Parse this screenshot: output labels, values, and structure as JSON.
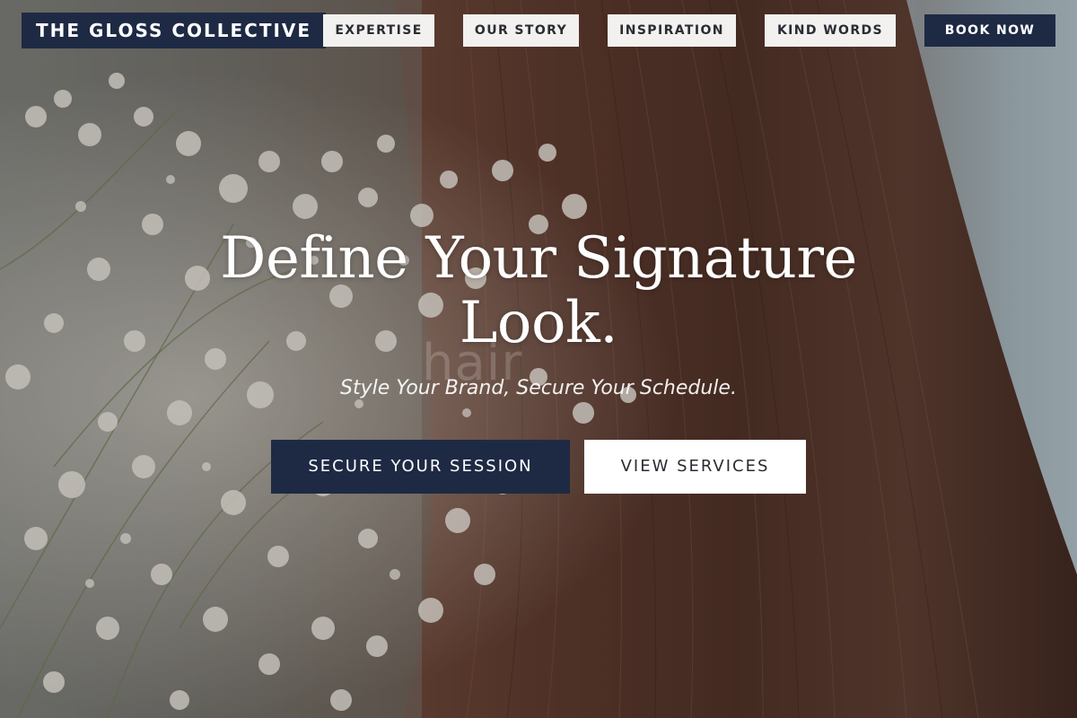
{
  "header": {
    "brand": "THE GLOSS COLLECTIVE",
    "nav": [
      {
        "id": "expertise",
        "label": "EXPERTISE"
      },
      {
        "id": "our-story",
        "label": "OUR STORY"
      },
      {
        "id": "inspiration",
        "label": "INSPIRATION"
      },
      {
        "id": "kind-words",
        "label": "KIND WORDS"
      }
    ],
    "cta": "BOOK NOW"
  },
  "hero": {
    "headline_line1": "Define Your Signature",
    "headline_line2": "Look.",
    "background_text": "hair",
    "subtitle": "Style Your Brand, Secure Your Schedule.",
    "primary_button": "SECURE YOUR SESSION",
    "secondary_button": "VIEW SERVICES"
  },
  "colors": {
    "brand_navy": "#1e2a44",
    "nav_button_bg": "#f2f1ef",
    "hero_text": "#ffffff"
  }
}
